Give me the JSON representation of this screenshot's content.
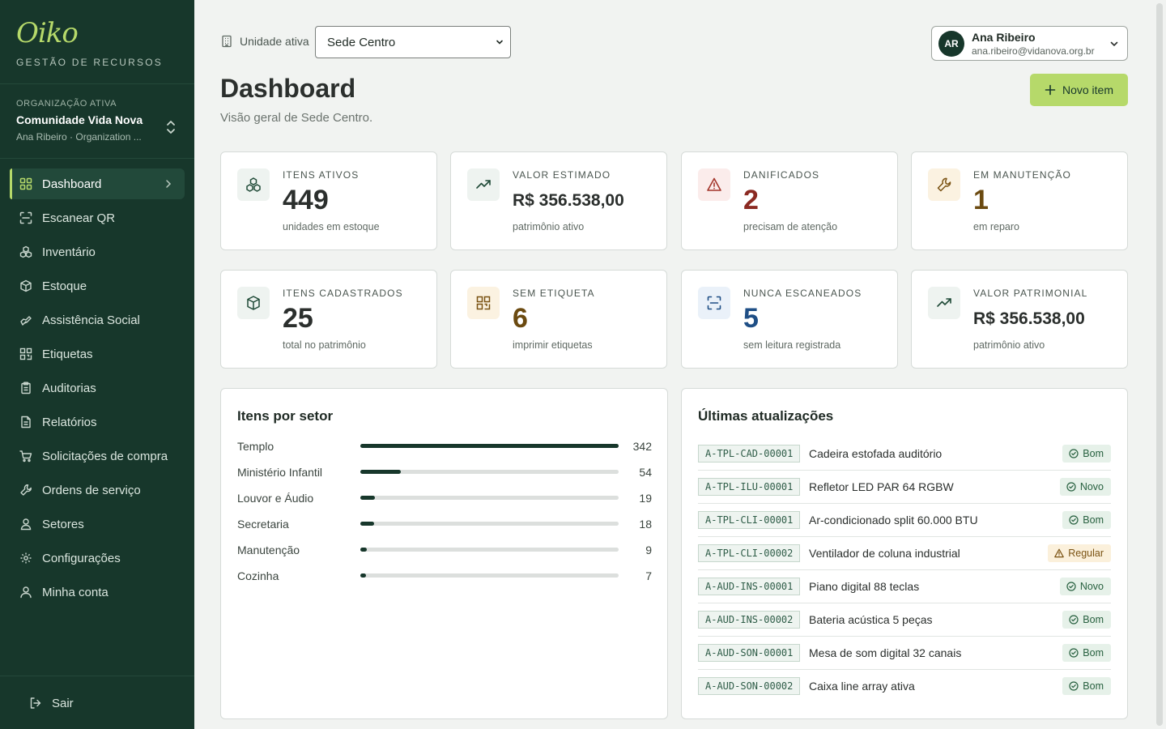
{
  "sidebar": {
    "logo": "Oiko",
    "tagline": "GESTÃO DE RECURSOS",
    "org_label": "ORGANIZAÇÃO ATIVA",
    "org_name": "Comunidade Vida Nova",
    "org_user": "Ana Ribeiro · Organization ...",
    "items": [
      {
        "label": "Dashboard",
        "icon": "grid-icon"
      },
      {
        "label": "Escanear QR",
        "icon": "scan-icon"
      },
      {
        "label": "Inventário",
        "icon": "boxes-icon"
      },
      {
        "label": "Estoque",
        "icon": "package-icon"
      },
      {
        "label": "Assistência Social",
        "icon": "handshake-icon"
      },
      {
        "label": "Etiquetas",
        "icon": "qr-code-icon"
      },
      {
        "label": "Auditorias",
        "icon": "clipboard-icon"
      },
      {
        "label": "Relatórios",
        "icon": "file-text-icon"
      },
      {
        "label": "Solicitações de compra",
        "icon": "cart-icon"
      },
      {
        "label": "Ordens de serviço",
        "icon": "wrench-icon"
      },
      {
        "label": "Setores",
        "icon": "users-icon"
      },
      {
        "label": "Configurações",
        "icon": "gear-icon"
      },
      {
        "label": "Minha conta",
        "icon": "user-icon"
      }
    ],
    "logout": "Sair"
  },
  "header": {
    "unit_label": "Unidade ativa",
    "unit_value": "Sede Centro",
    "user_initials": "AR",
    "user_name": "Ana Ribeiro",
    "user_email": "ana.ribeiro@vidanova.org.br",
    "title": "Dashboard",
    "subtitle": "Visão geral de Sede Centro.",
    "new_button": "Novo item"
  },
  "stats": [
    {
      "label": "ITENS ATIVOS",
      "value": "449",
      "hint": "unidades em estoque",
      "icon": "boxes-icon",
      "color": "#2b2f2d"
    },
    {
      "label": "VALOR ESTIMADO",
      "value": "R$ 356.538,00",
      "hint": "patrimônio ativo",
      "icon": "trend-up-icon",
      "color": "#2b2f2d"
    },
    {
      "label": "DANIFICADOS",
      "value": "2",
      "hint": "precisam de atenção",
      "icon": "alert-triangle-icon",
      "color": "#8b2a22"
    },
    {
      "label": "EM MANUTENÇÃO",
      "value": "1",
      "hint": "em reparo",
      "icon": "wrench-icon",
      "color": "#6b4a10"
    },
    {
      "label": "ITENS CADASTRADOS",
      "value": "25",
      "hint": "total no patrimônio",
      "icon": "package-icon",
      "color": "#2b2f2d"
    },
    {
      "label": "SEM ETIQUETA",
      "value": "6",
      "hint": "imprimir etiquetas",
      "icon": "qr-code-icon",
      "color": "#6b4a10"
    },
    {
      "label": "NUNCA ESCANEADOS",
      "value": "5",
      "hint": "sem leitura registrada",
      "icon": "scan-icon",
      "color": "#1f4f86"
    },
    {
      "label": "VALOR PATRIMONIAL",
      "value": "R$ 356.538,00",
      "hint": "patrimônio ativo",
      "icon": "trend-up-icon",
      "color": "#2b2f2d"
    }
  ],
  "sectors": {
    "title": "Itens por setor",
    "max": 342,
    "rows": [
      {
        "name": "Templo",
        "count": 342
      },
      {
        "name": "Ministério Infantil",
        "count": 54
      },
      {
        "name": "Louvor e Áudio",
        "count": 19
      },
      {
        "name": "Secretaria",
        "count": 18
      },
      {
        "name": "Manutenção",
        "count": 9
      },
      {
        "name": "Cozinha",
        "count": 7
      }
    ]
  },
  "updates": {
    "title": "Últimas atualizações",
    "rows": [
      {
        "code": "A-TPL-CAD-00001",
        "name": "Cadeira estofada auditório",
        "status": "Bom",
        "kind": "good"
      },
      {
        "code": "A-TPL-ILU-00001",
        "name": "Refletor LED PAR 64 RGBW",
        "status": "Novo",
        "kind": "new"
      },
      {
        "code": "A-TPL-CLI-00001",
        "name": "Ar-condicionado split 60.000 BTU",
        "status": "Bom",
        "kind": "good"
      },
      {
        "code": "A-TPL-CLI-00002",
        "name": "Ventilador de coluna industrial",
        "status": "Regular",
        "kind": "regular"
      },
      {
        "code": "A-AUD-INS-00001",
        "name": "Piano digital 88 teclas",
        "status": "Novo",
        "kind": "new"
      },
      {
        "code": "A-AUD-INS-00002",
        "name": "Bateria acústica 5 peças",
        "status": "Bom",
        "kind": "good"
      },
      {
        "code": "A-AUD-SON-00001",
        "name": "Mesa de som digital 32 canais",
        "status": "Bom",
        "kind": "good"
      },
      {
        "code": "A-AUD-SON-00002",
        "name": "Caixa line array ativa",
        "status": "Bom",
        "kind": "good"
      }
    ]
  }
}
